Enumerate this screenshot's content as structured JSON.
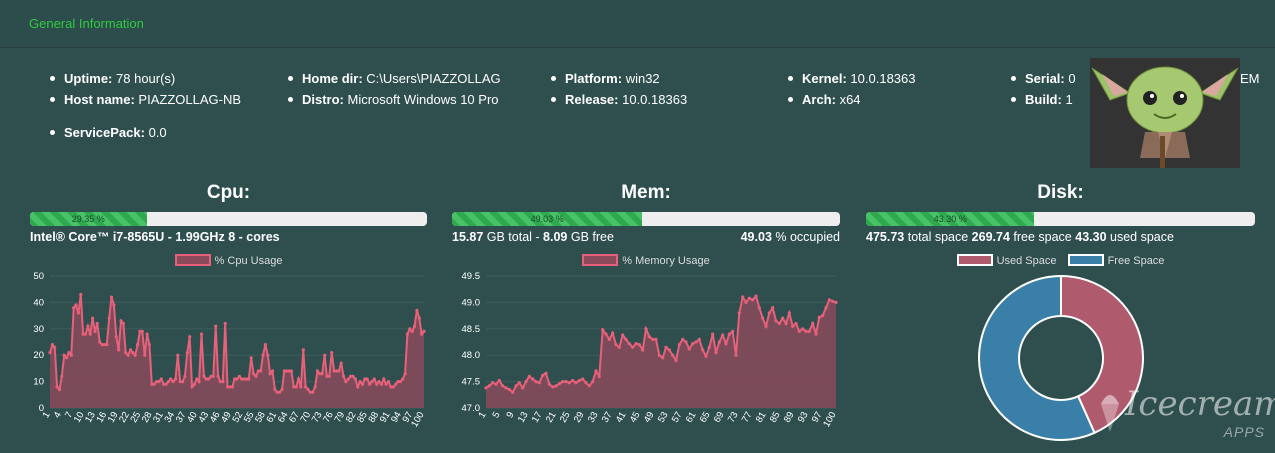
{
  "header": {
    "title": "General Information"
  },
  "info": {
    "col1": [
      {
        "label": "Uptime:",
        "value": "78 hour(s)"
      },
      {
        "label": "Host name:",
        "value": "PIAZZOLLAG-NB"
      },
      {
        "label": "ServicePack:",
        "value": "0.0"
      }
    ],
    "col2": [
      {
        "label": "Home dir:",
        "value": "C:\\Users\\PIAZZOLLAG"
      },
      {
        "label": "Distro:",
        "value": "Microsoft Windows 10 Pro"
      }
    ],
    "col3": [
      {
        "label": "Platform:",
        "value": "win32"
      },
      {
        "label": "Release:",
        "value": "10.0.18363"
      }
    ],
    "col4": [
      {
        "label": "Kernel:",
        "value": "10.0.18363"
      },
      {
        "label": "Arch:",
        "value": "x64"
      }
    ],
    "col5": [
      {
        "label": "Serial:",
        "value": "0"
      },
      {
        "label": "Build:",
        "value": "1"
      }
    ],
    "col5_trailing": "EM"
  },
  "cpu": {
    "title": "Cpu:",
    "progress_percent": 29.35,
    "progress_label": "29.35 %",
    "model": "Intel® Core™ i7-8565U - 1.99GHz",
    "cores": "8 - cores",
    "legend": "% Cpu Usage"
  },
  "mem": {
    "title": "Mem:",
    "progress_percent": 49.03,
    "progress_label": "49.03 %",
    "total_value": "15.87",
    "total_text": "GB total -",
    "free_value": "8.09",
    "free_text": "GB free",
    "occupied_value": "49.03",
    "occupied_text": "% occupied",
    "legend": "% Memory Usage"
  },
  "disk": {
    "title": "Disk:",
    "progress_percent": 43.3,
    "progress_label": "43.30 %",
    "total_value": "475.73",
    "total_text": "total space",
    "free_value": "269.74",
    "free_text": "free space",
    "used_value": "43.30",
    "used_text": "used space",
    "legend_used": "Used Space",
    "legend_free": "Free Space"
  },
  "colors": {
    "background": "#2f4f4f",
    "header_title": "#2ecc40",
    "series_line": "#e8607a",
    "series_fill": "#8a4a5a",
    "used_space": "#b05a6e",
    "free_space": "#3a7fa8"
  },
  "watermark": {
    "brand": "Icecream",
    "sub": "APPS"
  },
  "chart_data": [
    {
      "type": "area",
      "name": "cpu",
      "series": [
        {
          "name": "% Cpu Usage",
          "values": [
            21,
            24,
            23,
            8,
            7,
            12,
            20,
            19,
            21,
            20,
            38,
            39,
            36,
            43,
            28,
            28,
            31,
            28,
            34,
            29,
            32,
            25,
            24,
            24,
            24,
            34,
            42,
            39,
            27,
            22,
            33,
            32,
            21,
            20,
            22,
            21,
            20,
            24,
            29,
            29,
            20,
            28,
            24,
            9,
            9,
            10,
            10,
            11,
            9,
            9,
            10,
            11,
            10,
            11,
            20,
            10,
            10,
            12,
            21,
            27,
            8,
            9,
            11,
            10,
            28,
            12,
            11,
            11,
            12,
            12,
            31,
            12,
            10,
            10,
            32,
            8,
            8,
            8,
            11,
            11,
            12,
            11,
            11,
            11,
            11,
            19,
            13,
            12,
            14,
            14,
            20,
            24,
            20,
            13,
            14,
            7,
            6,
            6,
            7,
            14,
            14,
            14,
            14,
            8,
            8,
            11,
            8,
            22,
            8,
            7,
            6,
            6,
            8,
            14,
            13,
            13,
            20,
            12,
            12,
            21,
            14,
            14,
            14,
            17,
            12,
            10,
            11,
            12,
            12,
            11,
            8,
            10,
            9,
            11,
            11,
            9,
            10,
            11,
            9,
            10,
            9,
            11,
            9,
            10,
            8,
            8,
            9,
            10,
            10,
            11,
            13,
            28,
            30,
            29,
            31,
            37,
            34,
            28,
            29
          ]
        }
      ],
      "x_tick_labels": [
        "1",
        "4",
        "7",
        "10",
        "13",
        "16",
        "19",
        "22",
        "25",
        "28",
        "31",
        "34",
        "37",
        "40",
        "43",
        "46",
        "49",
        "52",
        "55",
        "58",
        "61",
        "64",
        "67",
        "70",
        "73",
        "76",
        "79",
        "82",
        "85",
        "88",
        "91",
        "94",
        "97",
        "100"
      ],
      "ylim": [
        0,
        50
      ],
      "y_ticks": [
        0,
        10,
        20,
        30,
        40,
        50
      ]
    },
    {
      "type": "area",
      "name": "mem",
      "series": [
        {
          "name": "% Memory Usage",
          "values": [
            47.38,
            47.42,
            47.48,
            47.45,
            47.52,
            47.42,
            47.38,
            47.35,
            47.3,
            47.42,
            47.48,
            47.38,
            47.5,
            47.6,
            47.55,
            47.5,
            47.48,
            47.62,
            47.66,
            47.45,
            47.4,
            47.42,
            47.46,
            47.5,
            47.5,
            47.48,
            47.52,
            47.48,
            47.52,
            47.55,
            47.48,
            47.42,
            47.5,
            47.7,
            47.6,
            48.48,
            48.4,
            48.3,
            48.42,
            48.2,
            48.15,
            48.38,
            48.3,
            48.22,
            48.15,
            48.22,
            48.2,
            48.1,
            48.5,
            48.35,
            48.3,
            48.3,
            48.0,
            47.95,
            48.15,
            48.1,
            48.0,
            47.9,
            48.2,
            48.3,
            48.25,
            48.12,
            48.22,
            48.25,
            48.3,
            48.1,
            47.98,
            48.15,
            48.4,
            48.05,
            48.25,
            48.38,
            48.22,
            48.4,
            48.45,
            48.0,
            48.8,
            49.1,
            49.0,
            49.08,
            49.05,
            49.12,
            48.9,
            48.7,
            48.55,
            48.8,
            48.9,
            48.65,
            48.6,
            48.7,
            48.6,
            48.8,
            48.55,
            48.6,
            48.45,
            48.5,
            48.45,
            48.45,
            48.6,
            48.4,
            48.72,
            48.75,
            48.9,
            49.05,
            49.02,
            49.0
          ]
        }
      ],
      "x_tick_labels": [
        "1",
        "5",
        "9",
        "13",
        "17",
        "21",
        "25",
        "29",
        "33",
        "37",
        "41",
        "45",
        "49",
        "53",
        "57",
        "61",
        "65",
        "69",
        "73",
        "77",
        "81",
        "85",
        "89",
        "93",
        "97",
        "100"
      ],
      "ylim": [
        47.0,
        49.5
      ],
      "y_ticks": [
        47.0,
        47.5,
        48.0,
        48.5,
        49.0,
        49.5
      ]
    },
    {
      "type": "pie",
      "name": "disk",
      "categories": [
        "Used Space",
        "Free Space"
      ],
      "values": [
        43.3,
        56.7
      ]
    }
  ]
}
